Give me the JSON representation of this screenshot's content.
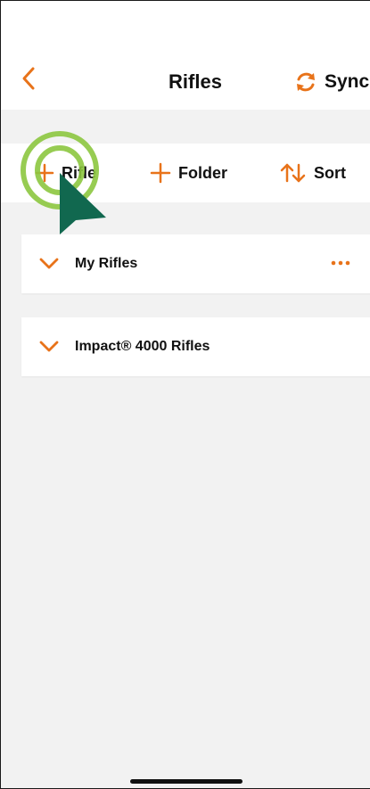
{
  "nav": {
    "title": "Rifles",
    "sync_label": "Sync"
  },
  "toolbar": {
    "add_rifle_label": "Rifle",
    "add_folder_label": "Folder",
    "sort_label": "Sort"
  },
  "folders": [
    {
      "label": "My Rifles",
      "has_more_menu": true
    },
    {
      "label": "Impact® 4000 Rifles",
      "has_more_menu": false
    }
  ],
  "colors": {
    "accent": "#e8731a",
    "cursor_ring": "#8cc63f",
    "cursor_pointer": "#11684f",
    "background": "#f2f2f2"
  },
  "icons": [
    "chevron-left-icon",
    "sync-icon",
    "plus-icon",
    "sort-icon",
    "chevron-down-icon",
    "more-icon",
    "cursor-pointer-icon"
  ]
}
